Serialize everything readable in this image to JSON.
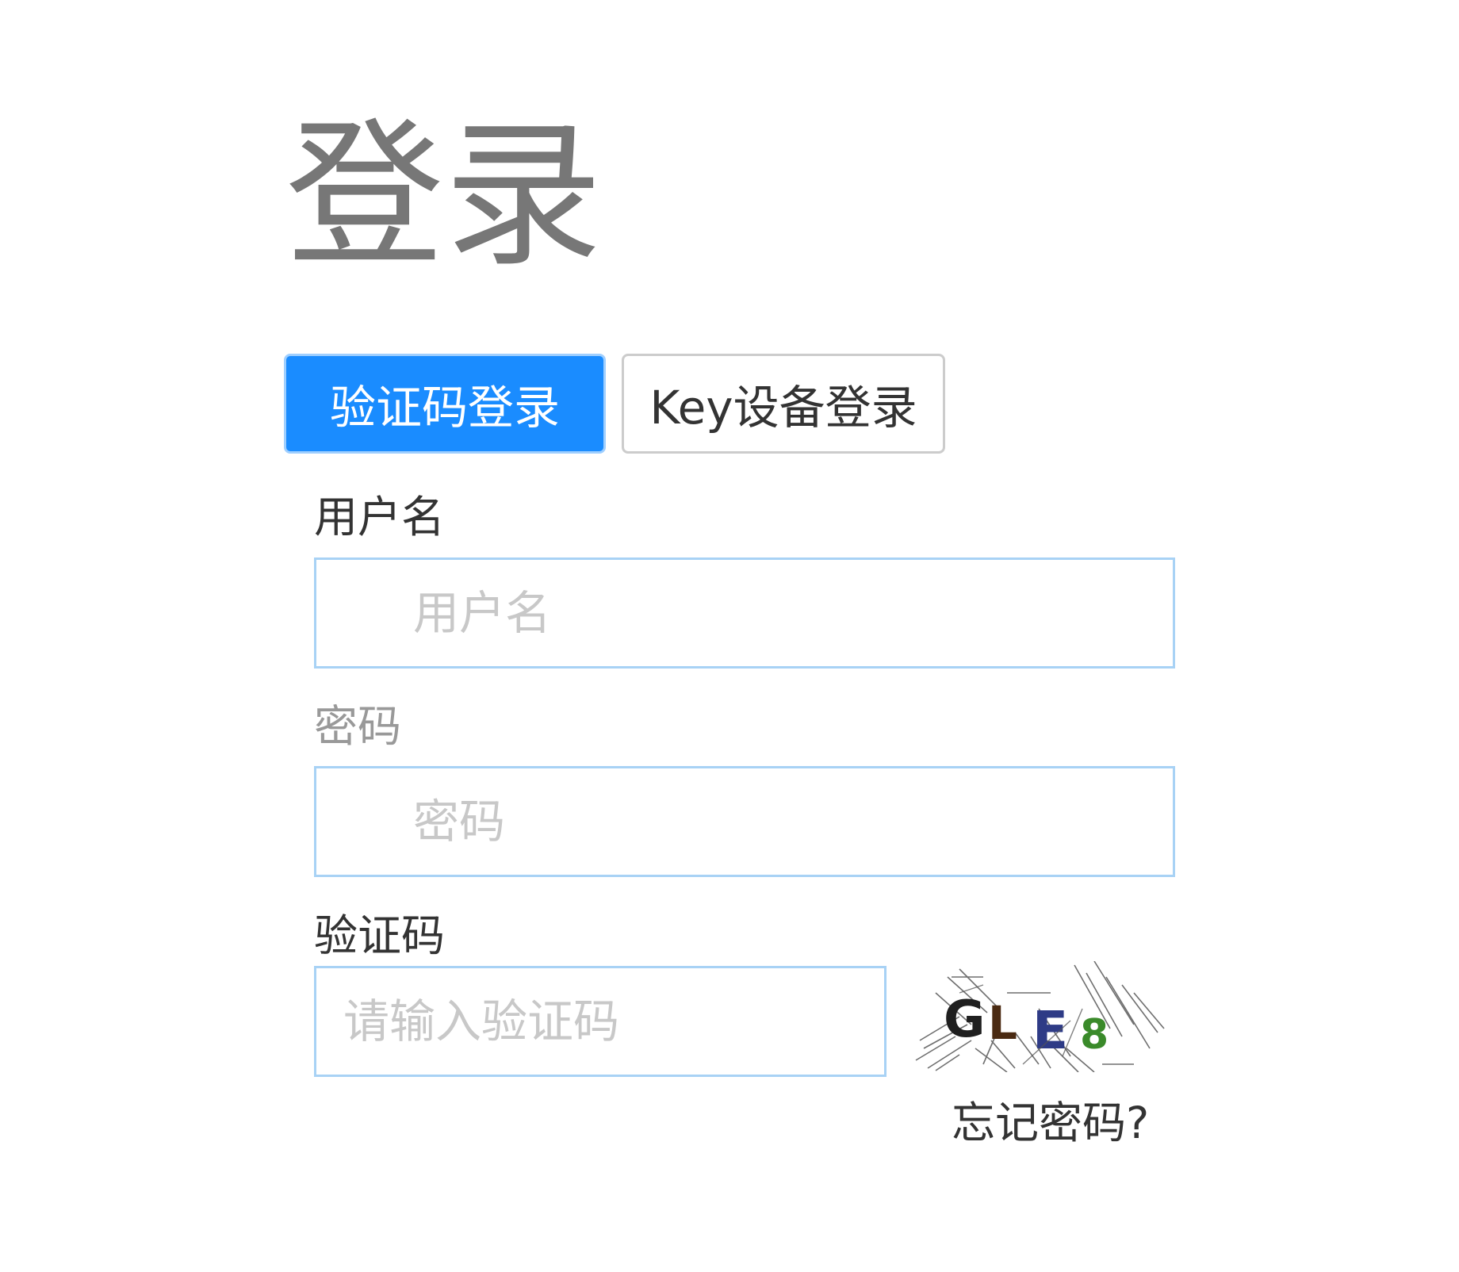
{
  "page": {
    "title": "登录"
  },
  "tabs": [
    {
      "label": "验证码登录",
      "active": true
    },
    {
      "label": "Key设备登录",
      "active": false
    }
  ],
  "form": {
    "username": {
      "label": "用户名",
      "placeholder": "用户名",
      "value": ""
    },
    "password": {
      "label": "密码",
      "placeholder": "密码",
      "value": ""
    },
    "captcha": {
      "label": "验证码",
      "placeholder": "请输入验证码",
      "value": "",
      "image_text": "GLE8"
    },
    "forgot_password_label": "忘记密码?"
  },
  "colors": {
    "accent": "#1a8cff",
    "input_border": "#a8d2f5",
    "title": "#777777"
  }
}
